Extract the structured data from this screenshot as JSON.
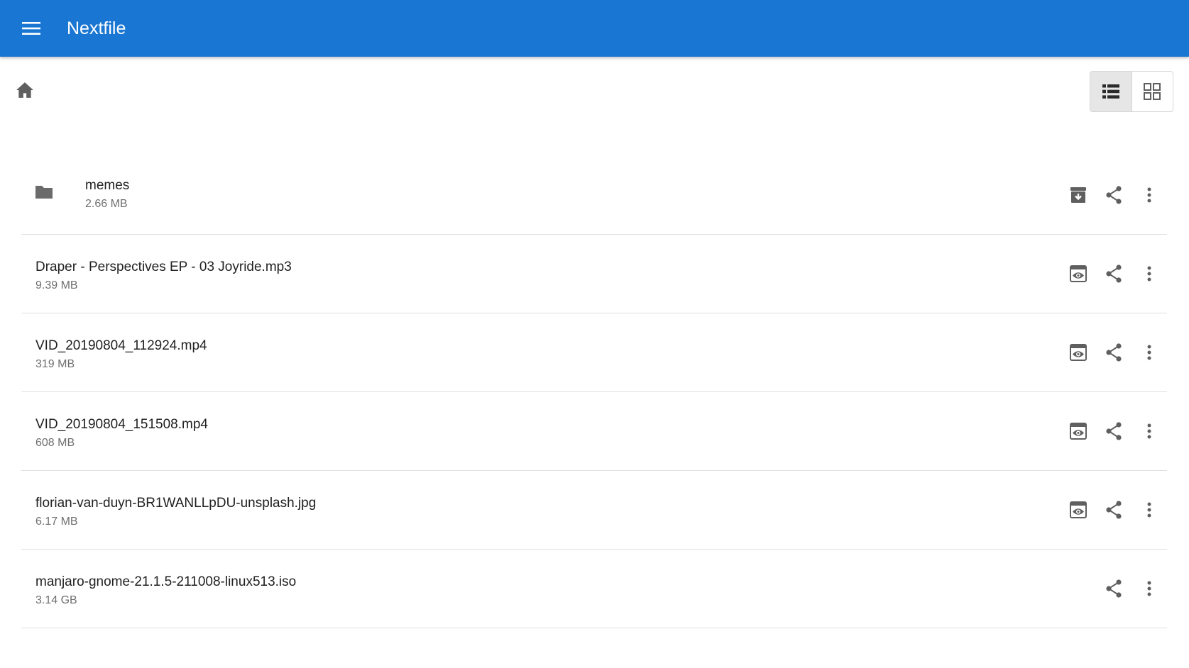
{
  "app": {
    "title": "Nextfile",
    "bar_color": "#1976d2"
  },
  "toolbar": {
    "home_icon": "home-icon",
    "view_modes": [
      {
        "name": "list-view",
        "icon": "list-icon",
        "active": true
      },
      {
        "name": "grid-view",
        "icon": "grid-icon",
        "active": false
      }
    ]
  },
  "files": [
    {
      "type": "folder",
      "name": "memes",
      "size": "2.66 MB",
      "primary_action": "download-archive-icon"
    },
    {
      "type": "file",
      "name": "Draper - Perspectives EP - 03 Joyride.mp3",
      "size": "9.39 MB",
      "primary_action": "preview-icon"
    },
    {
      "type": "file",
      "name": "VID_20190804_112924.mp4",
      "size": "319 MB",
      "primary_action": "preview-icon"
    },
    {
      "type": "file",
      "name": "VID_20190804_151508.mp4",
      "size": "608 MB",
      "primary_action": "preview-icon"
    },
    {
      "type": "file",
      "name": "florian-van-duyn-BR1WANLLpDU-unsplash.jpg",
      "size": "6.17 MB",
      "primary_action": "preview-icon"
    },
    {
      "type": "file",
      "name": "manjaro-gnome-21.1.5-211008-linux513.iso",
      "size": "3.14 GB",
      "primary_action": null
    }
  ]
}
